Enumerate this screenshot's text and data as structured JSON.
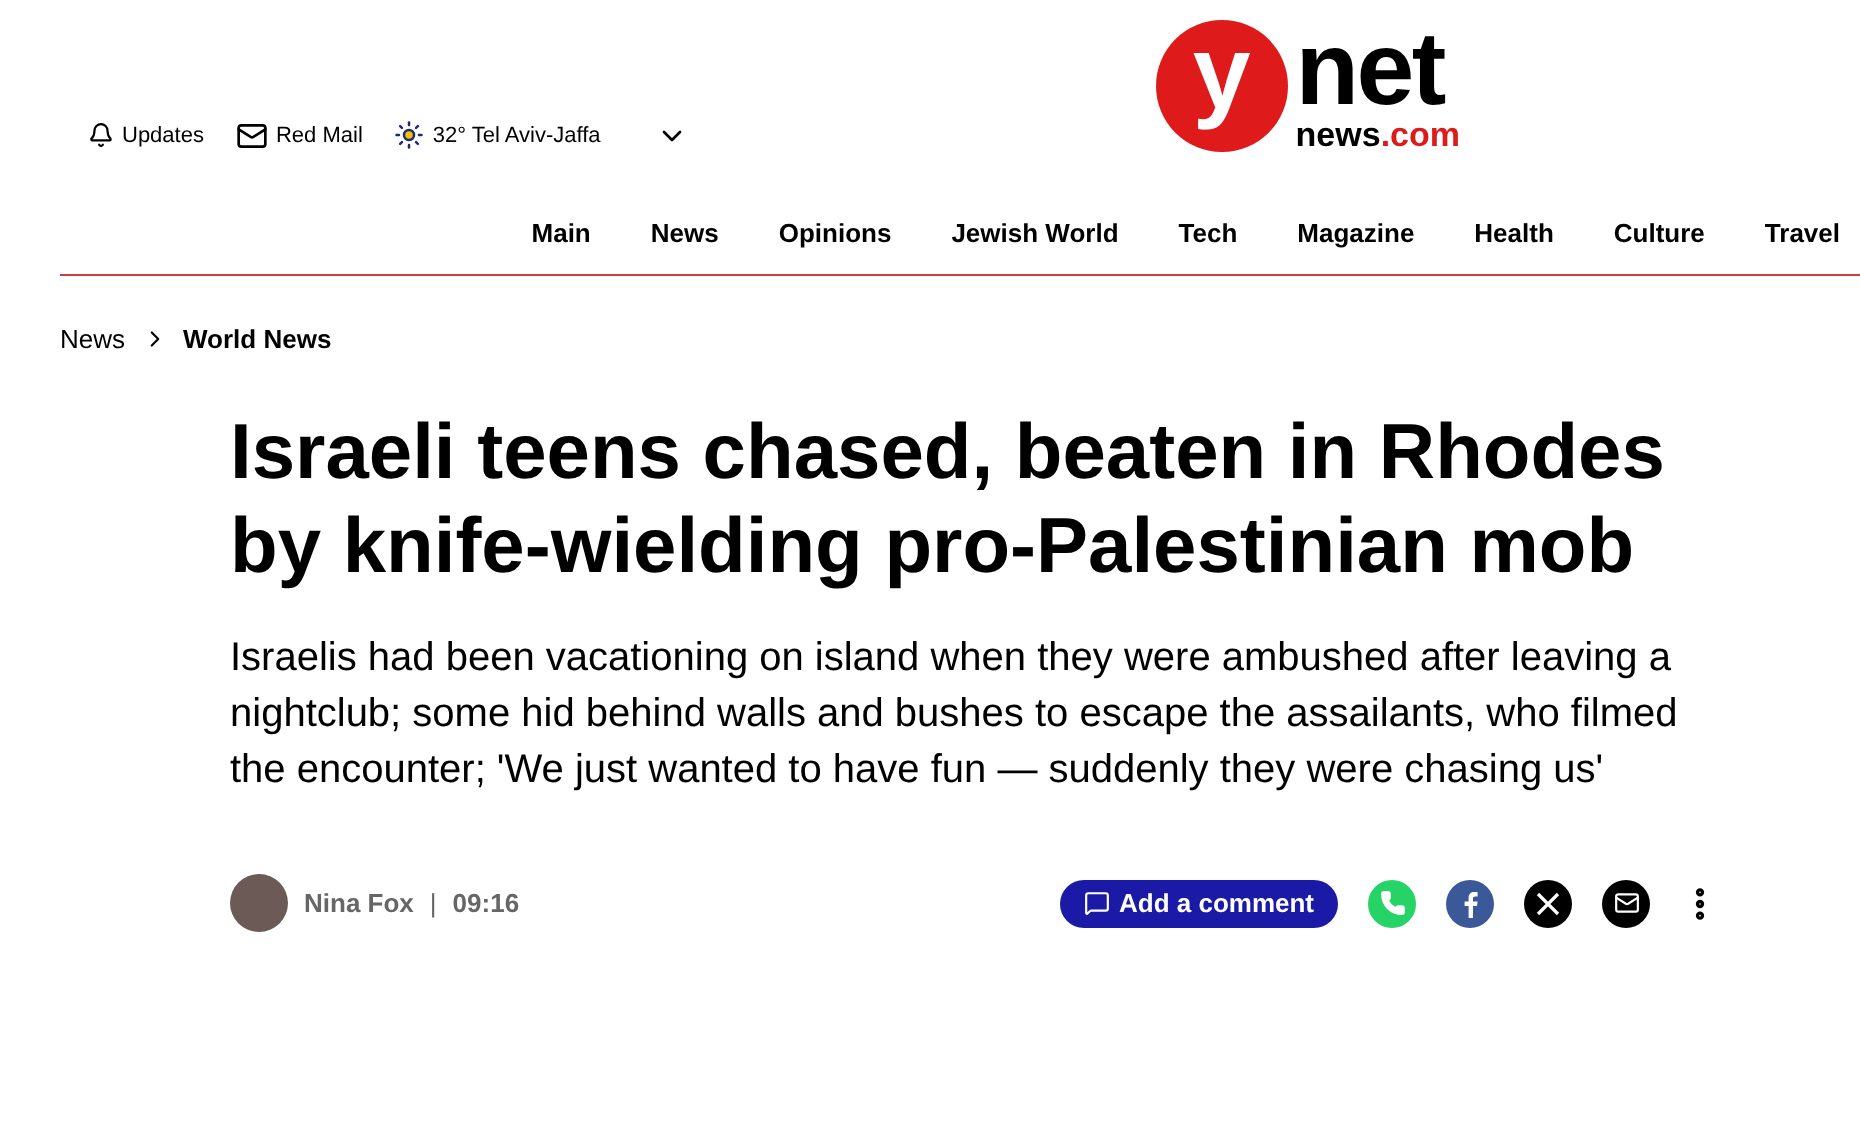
{
  "top_bar": {
    "updates": "Updates",
    "mail": "Red Mail",
    "weather": "32° Tel Aviv-Jaffa"
  },
  "logo": {
    "letter": "y",
    "word": "net",
    "site": "news",
    "domain": ".com"
  },
  "nav": [
    "Main",
    "News",
    "Opinions",
    "Jewish World",
    "Tech",
    "Magazine",
    "Health",
    "Culture",
    "Travel"
  ],
  "breadcrumb": [
    "News",
    "World News"
  ],
  "article": {
    "headline": "Israeli teens chased, beaten in Rhodes by knife-wielding pro-Palestinian mob",
    "subtitle": "Israelis had been vacationing on island when they were ambushed after leaving a nightclub; some hid behind walls and bushes to escape the assailants, who filmed the encounter; 'We just wanted to have fun — suddenly they were chasing us'",
    "author": "Nina Fox",
    "separator": "|",
    "time": "09:16",
    "comment_button": "Add a comment"
  },
  "share": [
    {
      "kind": "whatsapp",
      "color": "#25d366"
    },
    {
      "kind": "facebook",
      "color": "#3b5998"
    },
    {
      "kind": "x",
      "color": "#000000"
    },
    {
      "kind": "email",
      "color": "#000000"
    }
  ]
}
